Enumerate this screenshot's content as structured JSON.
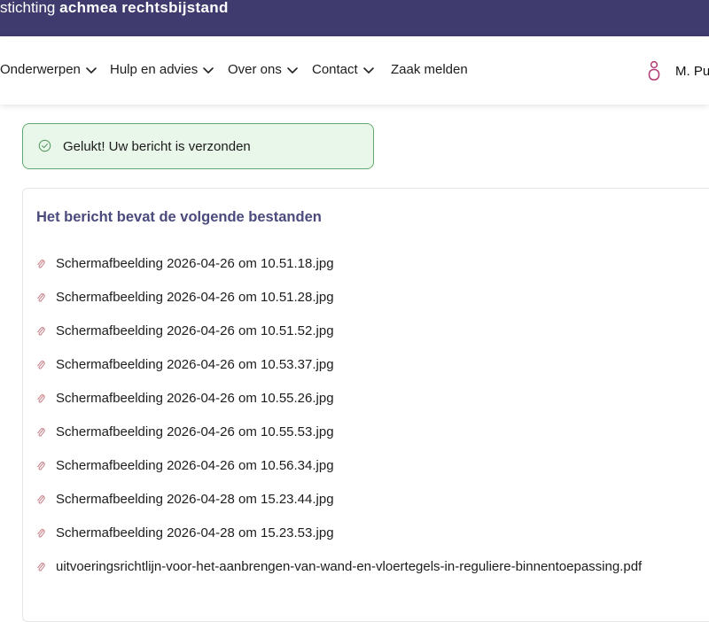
{
  "header": {
    "brand_light": "stichting",
    "brand_bold": "achmea rechtsbijstand"
  },
  "nav": {
    "items": [
      {
        "label": "Onderwerpen",
        "dropdown": true
      },
      {
        "label": "Hulp en advies",
        "dropdown": true
      },
      {
        "label": "Over ons",
        "dropdown": true
      },
      {
        "label": "Contact",
        "dropdown": true
      },
      {
        "label": "Zaak melden",
        "dropdown": false
      }
    ],
    "user_name": "M. Pu"
  },
  "alert": {
    "message": "Gelukt! Uw bericht is verzonden"
  },
  "attachments": {
    "title": "Het bericht bevat de volgende bestanden",
    "files": [
      "Schermafbeelding 2026-04-26 om 10.51.18.jpg",
      "Schermafbeelding 2026-04-26 om 10.51.28.jpg",
      "Schermafbeelding 2026-04-26 om 10.51.52.jpg",
      "Schermafbeelding 2026-04-26 om 10.53.37.jpg",
      "Schermafbeelding 2026-04-26 om 10.55.26.jpg",
      "Schermafbeelding 2026-04-26 om 10.55.53.jpg",
      "Schermafbeelding 2026-04-26 om 10.56.34.jpg",
      "Schermafbeelding 2026-04-28 om 15.23.44.jpg",
      "Schermafbeelding 2026-04-28 om 15.23.53.jpg",
      "uitvoeringsrichtlijn-voor-het-aanbrengen-van-wand-en-vloertegels-in-reguliere-binnentoepassing.pdf"
    ]
  },
  "colors": {
    "header_bg": "#3f3b6e",
    "title_color": "#4b4a7d",
    "success_bg": "#e9f6ea",
    "success_border": "#66a86d",
    "clip_color": "#c9868f",
    "user_icon_color": "#b23a73"
  },
  "icons": {
    "nav_dropdown": "chevron-down-icon",
    "user": "user-icon",
    "alert": "check-circle-icon",
    "attachment": "paperclip-icon"
  }
}
